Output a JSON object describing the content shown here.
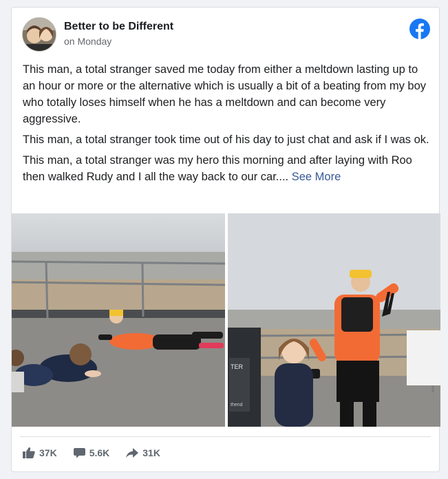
{
  "post": {
    "page_name": "Better to be Different",
    "timestamp": "on Monday",
    "paragraphs": [
      "This man, a total stranger saved me today from either a meltdown lasting up to an hour or more or the alternative which is usually a bit of a beating from my boy who totally loses himself when he has a meltdown and can become very aggressive.",
      "This man, a total stranger took time out of his day to just chat and ask if I was ok.",
      "This man, a total stranger was my hero this morning and after laying with Roo then walked Rudy and I all the way back to our car...."
    ],
    "see_more": "See More",
    "sign_text_top": "TER",
    "sign_text_bottom": "thend"
  },
  "stats": {
    "likes": "37K",
    "comments": "5.6K",
    "shares": "31K"
  },
  "colors": {
    "facebook_blue": "#1877f2",
    "link": "#385898",
    "muted": "#606770",
    "jacket_orange": "#f26b35"
  },
  "icons": {
    "logo": "facebook-logo-icon",
    "like": "thumbs-up-icon",
    "comment": "comment-icon",
    "share": "share-arrow-icon"
  }
}
